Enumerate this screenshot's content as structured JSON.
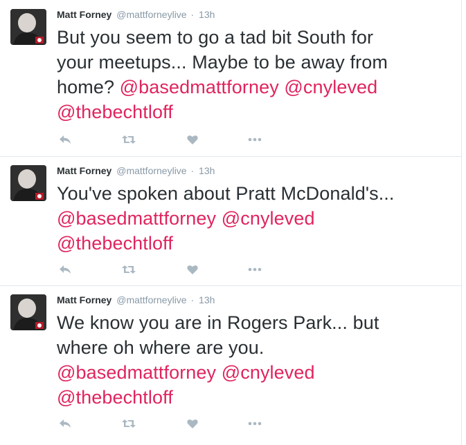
{
  "colors": {
    "mention": "#e0245e",
    "meta": "#8899a6",
    "text": "#292f33",
    "action_icon": "#aab8c2",
    "divider": "#e1e8ed"
  },
  "icons": {
    "reply": "reply-icon",
    "retweet": "retweet-icon",
    "like": "heart-icon",
    "more": "more-icon"
  },
  "tweets": [
    {
      "fullname": "Matt Forney",
      "username": "@mattforneylive",
      "separator": "·",
      "time": "13h",
      "text_lines": [
        "But you seem to go a tad bit South for",
        "your meetups... Maybe to be away from",
        "home?"
      ],
      "mentions": [
        "@basedmattforney",
        "@cnyleved",
        "@thebechtloff"
      ]
    },
    {
      "fullname": "Matt Forney",
      "username": "@mattforneylive",
      "separator": "·",
      "time": "13h",
      "text_lines": [
        "You've spoken about Pratt McDonald's..."
      ],
      "mentions": [
        "@basedmattforney",
        "@cnyleved",
        "@thebechtloff"
      ]
    },
    {
      "fullname": "Matt Forney",
      "username": "@mattforneylive",
      "separator": "·",
      "time": "13h",
      "text_lines": [
        "We know you are in Rogers Park... but",
        "where oh where are you."
      ],
      "mentions": [
        "@basedmattforney",
        "@cnyleved",
        "@thebechtloff"
      ]
    }
  ]
}
